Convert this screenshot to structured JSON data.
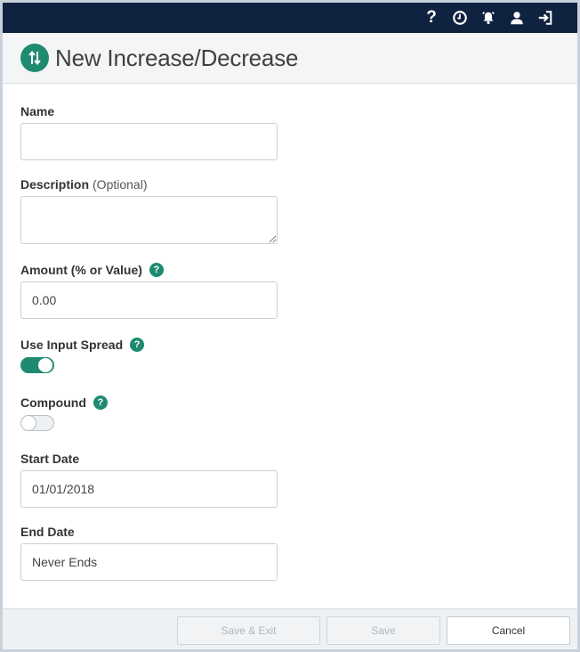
{
  "topbar": {
    "icons": [
      "help-icon",
      "history-clock-icon",
      "alarm-bell-icon",
      "user-icon",
      "sign-out-icon"
    ],
    "help_glyph": "?"
  },
  "header": {
    "title": "New Increase/Decrease",
    "icon": "arrows-up-down-icon"
  },
  "form": {
    "name": {
      "label": "Name",
      "value": "",
      "placeholder": ""
    },
    "description": {
      "label": "Description",
      "optional": "(Optional)",
      "value": ""
    },
    "amount": {
      "label": "Amount (% or Value)",
      "value": "0.00",
      "help": "?"
    },
    "use_input_spread": {
      "label": "Use Input Spread",
      "enabled": true,
      "help": "?"
    },
    "compound": {
      "label": "Compound",
      "enabled": false,
      "help": "?"
    },
    "start_date": {
      "label": "Start Date",
      "value": "01/01/2018"
    },
    "end_date": {
      "label": "End Date",
      "value": "Never Ends"
    }
  },
  "footer": {
    "save_exit_label": "Save & Exit",
    "save_label": "Save",
    "cancel_label": "Cancel"
  },
  "colors": {
    "topbar": "#0f2240",
    "accent": "#1f8a70",
    "header_bg": "#f3f5f6",
    "footer_bg": "#eef1f3"
  }
}
